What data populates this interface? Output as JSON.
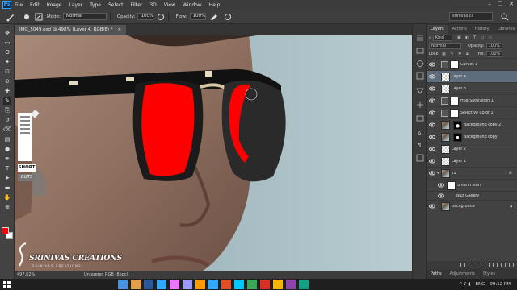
{
  "app": {
    "logo": "Ps"
  },
  "menu": [
    "File",
    "Edit",
    "Image",
    "Layer",
    "Type",
    "Select",
    "Filter",
    "3D",
    "View",
    "Window",
    "Help"
  ],
  "window_controls": [
    "–",
    "❐",
    "✕"
  ],
  "options": {
    "mode_label": "Mode:",
    "mode_value": "Normal",
    "opacity_label": "Opacity:",
    "opacity_value": "100%",
    "flow_label": "Flow:",
    "flow_value": "100%",
    "workspace": "srinivas.cs"
  },
  "document": {
    "tab_title": "IMG_5049.psd @ 498% (Layer 4, RGB/8) *",
    "zoom": "497.62%",
    "status": "Untagged RGB (8bpc)"
  },
  "tools": [
    "move-tool",
    "marquee-tool",
    "lasso-tool",
    "quick-select-tool",
    "crop-tool",
    "eyedropper-tool",
    "healing-tool",
    "brush-tool",
    "clone-tool",
    "history-brush-tool",
    "eraser-tool",
    "gradient-tool",
    "dodge-tool",
    "pen-tool",
    "type-tool",
    "path-select-tool",
    "shape-tool",
    "hand-tool",
    "zoom-tool"
  ],
  "colors": {
    "foreground": "#ff0000",
    "background": "#ffffff",
    "canvas_bg": "#a9c0c6"
  },
  "overlay": {
    "keyboard_badge": [
      "SHORT",
      "CUTS"
    ],
    "watermark_main": "SRINIVAS CREATIONS",
    "watermark_sub": "SRINIVAS CREATIONS"
  },
  "layers_panel": {
    "tabs": [
      "Layers",
      "Actions",
      "History",
      "Libraries"
    ],
    "filter_label": "Kind",
    "blend_mode": "Normal",
    "opacity_label": "Opacity:",
    "opacity_value": "100%",
    "lock_label": "Lock:",
    "fill_label": "Fill:",
    "fill_value": "100%",
    "layers": [
      {
        "name": "Curves 1",
        "kind": "adjustment",
        "visible": true,
        "active": false
      },
      {
        "name": "Layer 4",
        "kind": "pixel",
        "visible": true,
        "active": true
      },
      {
        "name": "Layer 3",
        "kind": "pixel",
        "visible": true,
        "active": false
      },
      {
        "name": "Hue/Saturation 1",
        "kind": "adjustment",
        "visible": true,
        "active": false
      },
      {
        "name": "Selective Color 1",
        "kind": "adjustment",
        "visible": true,
        "active": false
      },
      {
        "name": "Background copy 2",
        "kind": "photo-mask",
        "visible": true,
        "active": false
      },
      {
        "name": "Background copy",
        "kind": "photo-mask",
        "visible": true,
        "active": false
      },
      {
        "name": "Layer 2",
        "kind": "pixel",
        "visible": true,
        "active": false
      },
      {
        "name": "Layer 1",
        "kind": "pixel",
        "visible": true,
        "active": false
      },
      {
        "name": "e1",
        "kind": "smart",
        "visible": true,
        "active": false
      },
      {
        "name": "Smart Filters",
        "kind": "filter-mask",
        "visible": true,
        "active": false
      },
      {
        "name": "Blur Gallery",
        "kind": "filter",
        "visible": true,
        "active": false
      },
      {
        "name": "Background",
        "kind": "photo",
        "visible": true,
        "active": false
      }
    ],
    "bottom_tabs": [
      "Paths",
      "Adjustments",
      "Styles"
    ]
  },
  "taskbar": {
    "lang": "ENG",
    "time": "09:12 PM"
  }
}
